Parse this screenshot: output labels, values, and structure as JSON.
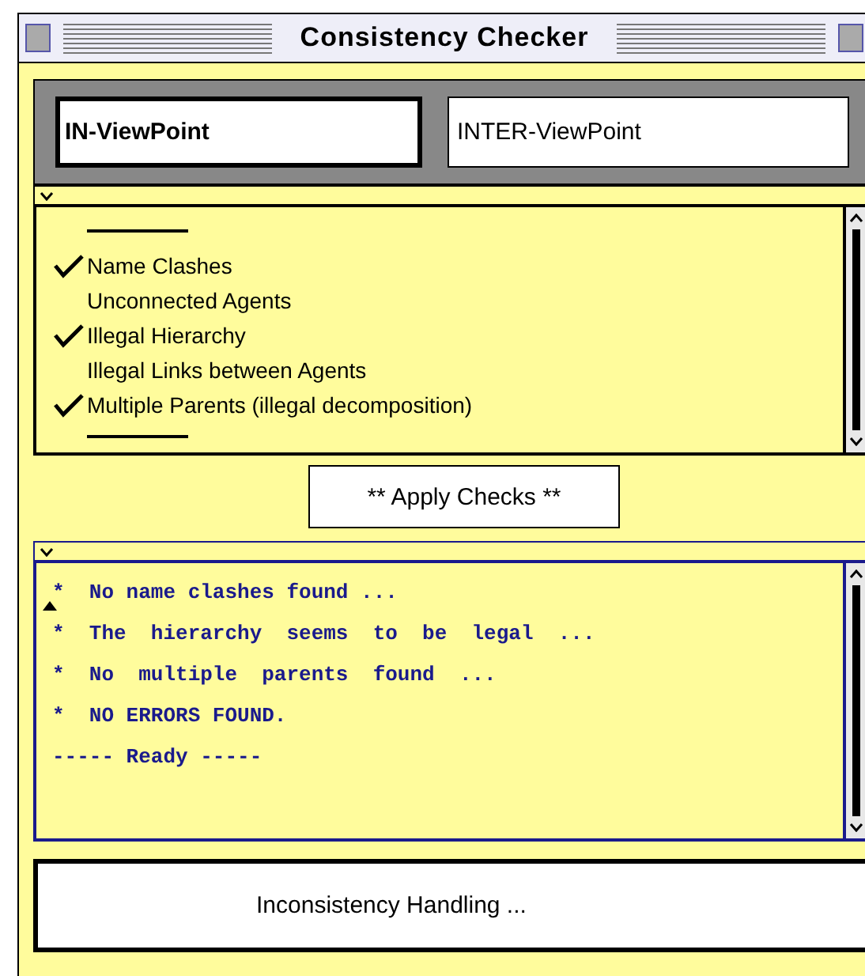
{
  "window": {
    "title": "Consistency Checker"
  },
  "tabs": [
    {
      "label": "IN-ViewPoint",
      "selected": true
    },
    {
      "label": "INTER-ViewPoint",
      "selected": false
    }
  ],
  "checks": [
    {
      "label": "Name Clashes",
      "checked": true
    },
    {
      "label": "Unconnected Agents",
      "checked": false
    },
    {
      "label": "Illegal Hierarchy",
      "checked": true
    },
    {
      "label": "Illegal Links between Agents",
      "checked": false
    },
    {
      "label": "Multiple Parents (illegal decomposition)",
      "checked": true
    }
  ],
  "apply_button": "** Apply Checks **",
  "output": {
    "lines": [
      "*  No name clashes found ...",
      "*  The  hierarchy  seems  to  be  legal  ...",
      "*  No  multiple  parents  found  ...",
      "*  NO ERRORS FOUND.",
      "----- Ready -----"
    ]
  },
  "handling_button": "Inconsistency Handling ..."
}
